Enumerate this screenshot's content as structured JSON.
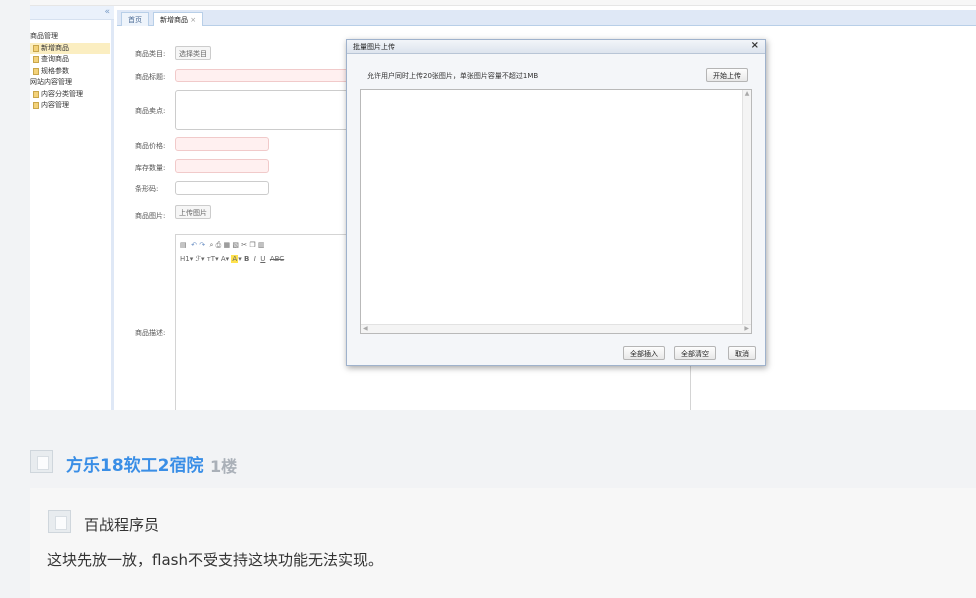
{
  "admin": {
    "tree": {
      "root": "商品管理",
      "items": [
        "新增商品",
        "查询商品",
        "规格参数"
      ],
      "root2": "网站内容管理",
      "items2": [
        "内容分类管理",
        "内容管理"
      ]
    },
    "tabs": [
      "首页",
      "新增商品"
    ],
    "form": {
      "category_label": "商品类目:",
      "category_button": "选择类目",
      "title_label": "商品标题:",
      "sellpoint_label": "商品卖点:",
      "price_label": "商品价格:",
      "stock_label": "库存数量:",
      "barcode_label": "条形码:",
      "image_label": "商品图片:",
      "image_button": "上传图片",
      "desc_label": "商品描述:"
    },
    "editor_toolbar": {
      "row2": [
        "H1",
        "B",
        "I",
        "U",
        "ABC"
      ]
    }
  },
  "dialog": {
    "title": "批量图片上传",
    "close": "×",
    "note": "允许用户同时上传20张图片，单张图片容量不超过1MB",
    "start_button": "开始上传",
    "insert_all_button": "全部插入",
    "clear_all_button": "全部清空",
    "cancel_button": "取消"
  },
  "post": {
    "author": "方乐18软工2宿院",
    "floor": "1楼",
    "reply_author": "百战程序员",
    "reply_text": "这块先放一放，flash不受支持这块功能无法实现。"
  },
  "colors": {
    "link_blue": "#3a8ee6",
    "panel_blue": "#dfe8f6",
    "required_pink": "#fff0f0"
  }
}
